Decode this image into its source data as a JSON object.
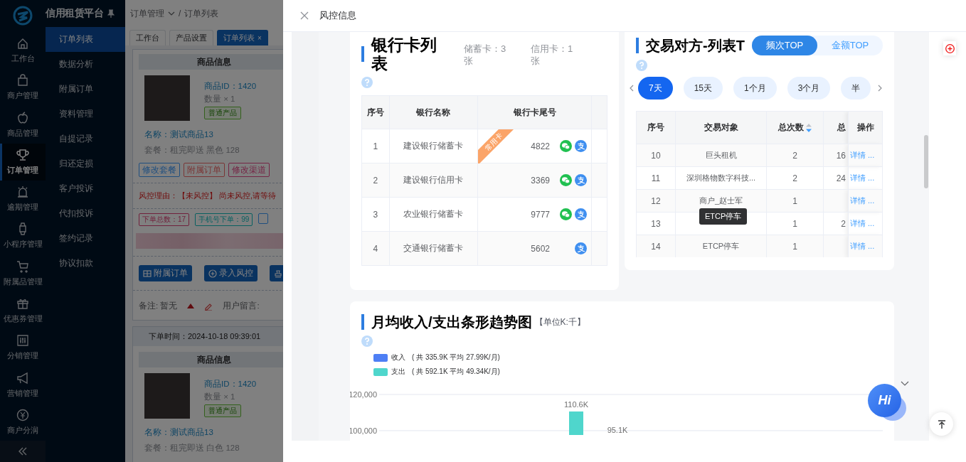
{
  "app": {
    "title": "信用租赁平台",
    "rail": [
      {
        "label": "工作台",
        "selected": false
      },
      {
        "label": "商户管理",
        "selected": false
      },
      {
        "label": "商品管理",
        "selected": false
      },
      {
        "label": "订单管理",
        "selected": true
      },
      {
        "label": "逾期管理",
        "selected": false
      },
      {
        "label": "小程序管理",
        "selected": false
      },
      {
        "label": "附属品管理",
        "selected": false
      },
      {
        "label": "优惠券管理",
        "selected": false
      },
      {
        "label": "分销管理",
        "selected": false
      },
      {
        "label": "营销管理",
        "selected": false
      },
      {
        "label": "商户分润",
        "selected": false
      }
    ],
    "submenu": [
      {
        "label": "订单列表",
        "selected": true
      },
      {
        "label": "数据分析",
        "selected": false
      },
      {
        "label": "附属订单",
        "selected": false
      },
      {
        "label": "资料管理",
        "selected": false
      },
      {
        "label": "自提记录",
        "selected": false
      },
      {
        "label": "归还定损",
        "selected": false
      },
      {
        "label": "客户投诉",
        "selected": false
      },
      {
        "label": "代扣投诉",
        "selected": false
      },
      {
        "label": "签约记录",
        "selected": false
      },
      {
        "label": "协议扣款",
        "selected": false
      }
    ],
    "breadcrumb": {
      "items": [
        "订单管理",
        "订单列表"
      ],
      "separator": "/"
    },
    "tabs": [
      {
        "label": "工作台",
        "selected": false
      },
      {
        "label": "产品设置",
        "selected": false
      },
      {
        "label": "订单列表",
        "selected": true,
        "close": "×"
      }
    ],
    "orders": [
      {
        "section_title": "商品信息",
        "product_id": "商品ID：1420",
        "quantity": "数量 × 1",
        "tag": "普通产品",
        "name_label": "名称：",
        "name": "测试商品13",
        "package": "套餐：租完即送 黑色 128",
        "actions": [
          {
            "label": "修改套餐",
            "color": "#204f7f"
          },
          {
            "label": "附属订单",
            "color": "#7a3636"
          },
          {
            "label": "修改渠道",
            "color": "#742545"
          }
        ],
        "risk_reason": "风控理由：【未风控】 尚未风控,请等待",
        "stats": [
          {
            "text": "下单总数：17",
            "color": "#70223d"
          },
          {
            "text": "手机号下单：99",
            "color": "#096161"
          },
          {
            "color": "#204f7f"
          }
        ],
        "buttons": [
          {
            "kind": "grid",
            "label": "附属订单"
          },
          {
            "kind": "add",
            "label": "录入风控"
          },
          {
            "kind": "stamp"
          }
        ],
        "note": "备注: 暂无",
        "message_label": "用户留言:"
      },
      {
        "order_time": "下单时间：2024-10-18 09:39:01",
        "section_title": "商品信息",
        "product_id": "商品ID：1420",
        "quantity": "数量 × 1",
        "tag": "普通产品",
        "name_label": "名称：",
        "name": "测试商品13",
        "package": "套餐：租完即送 白色 128"
      }
    ]
  },
  "drawer": {
    "title": "风控信息",
    "bank_cards": {
      "title": "银行卡列表",
      "stats": [
        "储蓄卡：3 张",
        "信用卡：1 张"
      ],
      "columns": [
        "序号",
        "银行名称",
        "银行卡尾号"
      ],
      "rows": [
        {
          "index": "1",
          "bank": "建设银行储蓄卡",
          "tail": "4822",
          "ribbon": "常用卡",
          "wechat": true,
          "alipay": true
        },
        {
          "index": "2",
          "bank": "建设银行信用卡",
          "tail": "3369",
          "wechat": true,
          "alipay": true
        },
        {
          "index": "3",
          "bank": "农业银行储蓄卡",
          "tail": "9777",
          "wechat": true,
          "alipay": true
        },
        {
          "index": "4",
          "bank": "交通银行储蓄卡",
          "tail": "5602",
          "wechat": false,
          "alipay": true
        }
      ]
    },
    "counterparties": {
      "title": "交易对方-列表T",
      "toggle": [
        {
          "label": "频次TOP",
          "selected": true
        },
        {
          "label": "金额TOP",
          "selected": false
        }
      ],
      "periods": [
        {
          "label": "7天",
          "selected": true
        },
        {
          "label": "15天",
          "selected": false
        },
        {
          "label": "1个月",
          "selected": false
        },
        {
          "label": "3个月",
          "selected": false
        },
        {
          "label": "半",
          "selected": false
        }
      ],
      "columns": [
        {
          "label": "序号",
          "sortable": false
        },
        {
          "label": "交易对象",
          "sortable": false
        },
        {
          "label": "总次数",
          "sortable": true
        },
        {
          "label": "总",
          "sortable": false
        },
        {
          "label": "操作",
          "sortable": false
        }
      ],
      "rows": [
        {
          "index": "10",
          "name": "巨头租机",
          "count": "2",
          "amount": "16",
          "action": "详情 ..."
        },
        {
          "index": "11",
          "name": "深圳格物数字科技...",
          "count": "2",
          "amount": "24",
          "action": "详情 ..."
        },
        {
          "index": "12",
          "name": "商户_赵士军",
          "count": "1",
          "action": "详情 ..."
        },
        {
          "index": "13",
          "count": "1",
          "amount": "2",
          "action": "详情 ...",
          "tooltip": "ETCP停车"
        },
        {
          "index": "14",
          "name": "ETCP停车",
          "count": "1",
          "action": "详情 ..."
        }
      ]
    },
    "trend": {
      "title": "月均收入/支出条形趋势图",
      "unit": "【单位K:千】",
      "legend_summaries": [
        "( 共 335.9K  平均 27.99K/月)",
        "( 共 592.1K  平均 49.34K/月)"
      ],
      "chart_data": {
        "type": "bar",
        "ylim": [
          97600,
          120000
        ],
        "yticks": [
          {
            "value": 100000,
            "label": "100,000"
          },
          {
            "value": 120000,
            "label": "120,000"
          }
        ],
        "stacked": false,
        "value_labels": [
          "110.6K"
        ],
        "annotations": [
          {
            "text": "95.1K"
          }
        ],
        "series": [
          {
            "name": "收入",
            "color": "#4e7ff5",
            "values": [
              null
            ]
          },
          {
            "name": "支出",
            "color": "#4fd6cc",
            "values": [
              110600
            ]
          }
        ]
      }
    },
    "chat_button": "Hi"
  }
}
